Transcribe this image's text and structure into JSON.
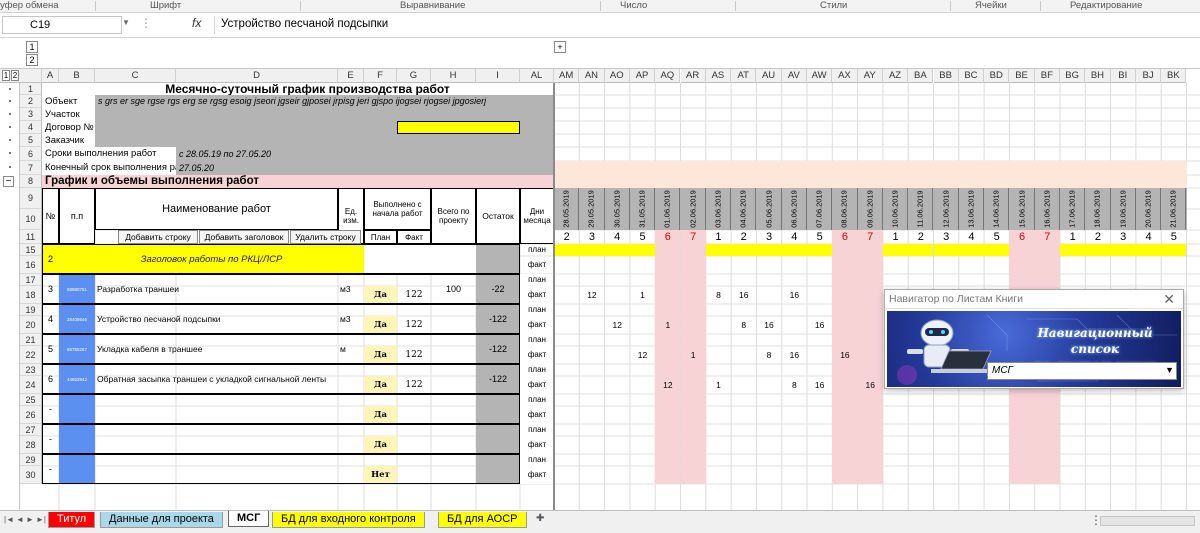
{
  "ribbon": {
    "groups": [
      "уфер обмена",
      "Шрифт",
      "Выравнивание",
      "Число",
      "Стили",
      "Ячейки",
      "Редактирование"
    ]
  },
  "formula_bar": {
    "name_box": "C19",
    "fx": "fx",
    "content": "Устройство песчаной подсыпки"
  },
  "outline": {
    "level_buttons_top": [
      "1",
      "2"
    ],
    "level_buttons_side": [
      "1",
      "2"
    ],
    "expand": "+"
  },
  "columns": [
    "A",
    "B",
    "C",
    "D",
    "E",
    "F",
    "G",
    "H",
    "I",
    "AL",
    "AM",
    "AN",
    "AO",
    "AP",
    "AQ",
    "AR",
    "AS",
    "AT",
    "AU",
    "AV",
    "AW",
    "AX",
    "AY",
    "AZ",
    "BA",
    "BB",
    "BC",
    "BD",
    "BE",
    "BF",
    "BG",
    "BH",
    "BI",
    "BJ",
    "BK"
  ],
  "rows": [
    "1",
    "2",
    "3",
    "4",
    "5",
    "6",
    "7",
    "8",
    "9",
    "10",
    "11",
    "15",
    "16",
    "17",
    "18",
    "19",
    "20",
    "21",
    "22",
    "23",
    "24",
    "25",
    "26",
    "27",
    "28",
    "29",
    "30"
  ],
  "sheet": {
    "title": "Месячно-суточный график производства работ",
    "object_label": "Объект",
    "object_value": "s grs er sge rgse rgs erg se rgsg esoig jseori jgseir gjposei jrpisg jeri gjspo ijogsei rjogsei jpgosierj",
    "site_label": "Участок",
    "contract_label": "Договор №",
    "customer_label": "Заказчик",
    "deadline_label": "Сроки выполнения работ",
    "deadline_value": "с 28.05.19 по 27.05.20",
    "final_label": "Конечный срок выполнения работ",
    "final_value": "27.05.20",
    "section_title": "График и объемы выполнения работ"
  },
  "table_header": {
    "num": "№",
    "pp": "п.п",
    "name": "Наименование работ",
    "unit": "Ед. изм.",
    "done": "Выполнено с начала работ",
    "total": "Всего по проекту",
    "remain": "Остаток",
    "days": "Дни месяца",
    "plan": "План",
    "fact": "Факт",
    "btn_add_row": "Добавить строку",
    "btn_add_header": "Добавить заголовок",
    "btn_delete_row": "Удалить строку"
  },
  "dates": [
    "28.05.2019",
    "29.05.2019",
    "30.05.2019",
    "31.05.2019",
    "01.06.2019",
    "02.06.2019",
    "03.06.2019",
    "04.06.2019",
    "05.06.2019",
    "06.06.2019",
    "07.06.2019",
    "08.06.2019",
    "09.06.2019",
    "10.06.2019",
    "11.06.2019",
    "12.06.2019",
    "13.06.2019",
    "14.06.2019",
    "15.06.2019",
    "16.06.2019",
    "17.06.2019",
    "18.06.2019",
    "19.06.2019",
    "20.06.2019",
    "21.06.2019"
  ],
  "weekdays": [
    "2",
    "3",
    "4",
    "5",
    "6",
    "7",
    "1",
    "2",
    "3",
    "4",
    "5",
    "6",
    "7",
    "1",
    "2",
    "3",
    "4",
    "5",
    "6",
    "7",
    "1",
    "2",
    "3",
    "4",
    "5"
  ],
  "weekend_cols": [
    4,
    5,
    11,
    12,
    18,
    19
  ],
  "plan_label": "план",
  "fact_label": "факт",
  "header_item": {
    "num": "2",
    "name": "Заголовок работы по РКЦ/ЛСР"
  },
  "items": [
    {
      "num": "3",
      "code": "88880751",
      "name": "Разработка траншеи",
      "unit": "м3",
      "done": "Да",
      "fact": "122",
      "total": "100",
      "remain": "-22",
      "days": [
        {
          "i": 1,
          "v": "12"
        },
        {
          "i": 3,
          "v": "1"
        },
        {
          "i": 6,
          "v": "8"
        },
        {
          "i": 7,
          "v": "16"
        },
        {
          "i": 9,
          "v": "16"
        }
      ]
    },
    {
      "num": "4",
      "code": "25408646",
      "name": "Устройство песчаной подсыпки",
      "unit": "м3",
      "done": "Да",
      "fact": "122",
      "total": "",
      "remain": "-122",
      "days": [
        {
          "i": 2,
          "v": "12"
        },
        {
          "i": 4,
          "v": "1"
        },
        {
          "i": 7,
          "v": "8"
        },
        {
          "i": 8,
          "v": "16"
        },
        {
          "i": 10,
          "v": "16"
        }
      ]
    },
    {
      "num": "5",
      "code": "65765267",
      "name": "Укладка кабеля в траншее",
      "unit": "м",
      "done": "Да",
      "fact": "122",
      "total": "",
      "remain": "-122",
      "days": [
        {
          "i": 3,
          "v": "12"
        },
        {
          "i": 5,
          "v": "1"
        },
        {
          "i": 8,
          "v": "8"
        },
        {
          "i": 9,
          "v": "16"
        },
        {
          "i": 11,
          "v": "16"
        }
      ]
    },
    {
      "num": "6",
      "code": "44653942",
      "name": "Обратная засыпка траншеи с укладкой сигнальной ленты",
      "unit": "",
      "done": "Да",
      "fact": "122",
      "total": "",
      "remain": "-122",
      "days": [
        {
          "i": 4,
          "v": "12"
        },
        {
          "i": 6,
          "v": "1"
        },
        {
          "i": 9,
          "v": "8"
        },
        {
          "i": 10,
          "v": "16"
        },
        {
          "i": 12,
          "v": "16"
        },
        {
          "i": 15,
          "v": "8"
        },
        {
          "i": 17,
          "v": "12"
        },
        {
          "i": 19,
          "v": "1"
        },
        {
          "i": 22,
          "v": "8"
        },
        {
          "i": 23,
          "v": "16"
        }
      ]
    },
    {
      "num": "-",
      "code": "",
      "name": "",
      "unit": "",
      "done": "Да",
      "fact": "",
      "total": "",
      "remain": "",
      "days": []
    },
    {
      "num": "-",
      "code": "",
      "name": "",
      "unit": "",
      "done": "Да",
      "fact": "",
      "total": "",
      "remain": "",
      "days": []
    },
    {
      "num": "-",
      "code": "",
      "name": "",
      "unit": "",
      "done": "Нет",
      "fact": "",
      "total": "",
      "remain": "",
      "days": []
    }
  ],
  "navigator": {
    "title": "Навигатор по Листам Книги",
    "heading_line1": "Навигационный список",
    "heading_line2": "по листам книги",
    "selected_sheet": "МСГ"
  },
  "tabs": [
    {
      "label": "Титул",
      "color": "#ff0000",
      "active": false
    },
    {
      "label": "Данные для проекта",
      "color": "#a8d8ea",
      "active": false
    },
    {
      "label": "МСГ",
      "color": "#ffffff",
      "active": true
    },
    {
      "label": "БД для входного контроля",
      "color": "#ffff00",
      "active": false
    },
    {
      "label": "БД для АОСР",
      "color": "#ffff00",
      "active": false
    }
  ],
  "colors": {
    "gray": "#b4b4b4",
    "yellow": "#ffff00",
    "pink": "#f8d3d6",
    "blue_code": "#5b8ff0",
    "light_yellow": "#fff5b8",
    "peach": "#fde7d9"
  }
}
